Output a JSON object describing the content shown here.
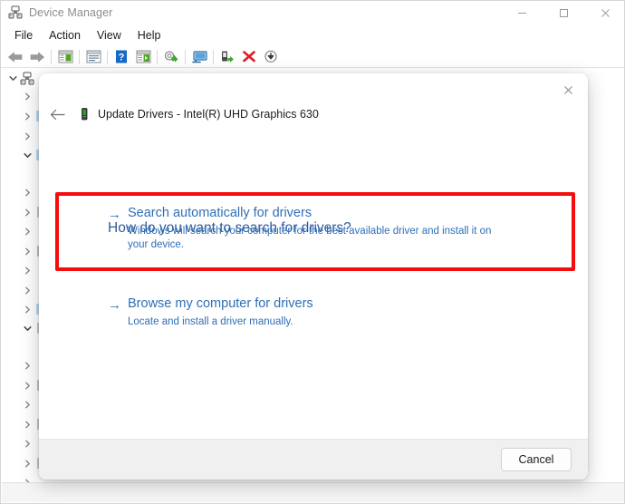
{
  "window": {
    "title": "Device Manager",
    "app_icon": "device-manager-icon",
    "controls": {
      "minimize": "–",
      "maximize": "□",
      "close": "✕"
    }
  },
  "menubar": {
    "items": [
      {
        "label": "File"
      },
      {
        "label": "Action"
      },
      {
        "label": "View"
      },
      {
        "label": "Help"
      }
    ]
  },
  "toolbar": {
    "buttons": [
      {
        "name": "back-arrow-icon",
        "glyph": "←"
      },
      {
        "name": "forward-arrow-icon",
        "glyph": "→"
      },
      {
        "name": "separator-1",
        "glyph": ""
      },
      {
        "name": "show-hide-console-tree-icon",
        "glyph": ""
      },
      {
        "name": "separator-2",
        "glyph": ""
      },
      {
        "name": "properties-icon",
        "glyph": ""
      },
      {
        "name": "separator-3",
        "glyph": ""
      },
      {
        "name": "help-icon",
        "glyph": "?"
      },
      {
        "name": "scan-for-hardware-changes-icon",
        "glyph": ""
      },
      {
        "name": "separator-4",
        "glyph": ""
      },
      {
        "name": "update-driver-icon",
        "glyph": ""
      },
      {
        "name": "separator-5",
        "glyph": ""
      },
      {
        "name": "display-monitor-icon",
        "glyph": ""
      },
      {
        "name": "separator-6",
        "glyph": ""
      },
      {
        "name": "enable-device-icon",
        "glyph": ""
      },
      {
        "name": "uninstall-device-icon",
        "glyph": "✕"
      },
      {
        "name": "download-icon",
        "glyph": "↓"
      }
    ]
  },
  "tree": {
    "root": {
      "label": "",
      "expanded": true
    },
    "rows": [
      {
        "indent": 0,
        "state": "expanded",
        "icon": "computer-icon",
        "label": ""
      },
      {
        "indent": 1,
        "state": "collapsed",
        "icon": "",
        "label": ""
      },
      {
        "indent": 1,
        "state": "collapsed",
        "icon": "",
        "label": ""
      },
      {
        "indent": 1,
        "state": "collapsed",
        "icon": "",
        "label": ""
      },
      {
        "indent": 1,
        "state": "expanded",
        "icon": "",
        "label": ""
      },
      {
        "indent": 1,
        "state": "collapsed",
        "icon": "",
        "label": ""
      },
      {
        "indent": 1,
        "state": "collapsed",
        "icon": "",
        "label": ""
      },
      {
        "indent": 1,
        "state": "collapsed",
        "icon": "",
        "label": ""
      },
      {
        "indent": 1,
        "state": "collapsed",
        "icon": "",
        "label": ""
      },
      {
        "indent": 1,
        "state": "collapsed",
        "icon": "",
        "label": ""
      },
      {
        "indent": 1,
        "state": "collapsed",
        "icon": "",
        "label": ""
      },
      {
        "indent": 1,
        "state": "collapsed",
        "icon": "",
        "label": ""
      },
      {
        "indent": 1,
        "state": "expanded",
        "icon": "",
        "label": ""
      },
      {
        "indent": 1,
        "state": "collapsed",
        "icon": "",
        "label": ""
      },
      {
        "indent": 1,
        "state": "collapsed",
        "icon": "",
        "label": ""
      },
      {
        "indent": 1,
        "state": "collapsed",
        "icon": "",
        "label": ""
      },
      {
        "indent": 1,
        "state": "collapsed",
        "icon": "",
        "label": ""
      },
      {
        "indent": 1,
        "state": "collapsed",
        "icon": "",
        "label": ""
      },
      {
        "indent": 1,
        "state": "collapsed",
        "icon": "",
        "label": ""
      },
      {
        "indent": 1,
        "state": "collapsed",
        "icon": "",
        "label": ""
      }
    ],
    "chevron_collapsed": "❯",
    "chevron_expanded": "⌄"
  },
  "dialog": {
    "close_glyph": "✕",
    "back_glyph": "←",
    "device_icon": "device-icon",
    "caption": "Update Drivers - Intel(R) UHD Graphics 630",
    "heading": "How do you want to search for drivers?",
    "options": [
      {
        "arrow": "→",
        "title": "Search automatically for drivers",
        "desc": "Windows will search your computer for the best available driver and install it on your device.",
        "highlighted": true
      },
      {
        "arrow": "→",
        "title": "Browse my computer for drivers",
        "desc": "Locate and install a driver manually.",
        "highlighted": false
      }
    ],
    "footer": {
      "cancel_label": "Cancel"
    },
    "highlight_color": "#f60c0c",
    "link_color": "#2f6fb8"
  }
}
